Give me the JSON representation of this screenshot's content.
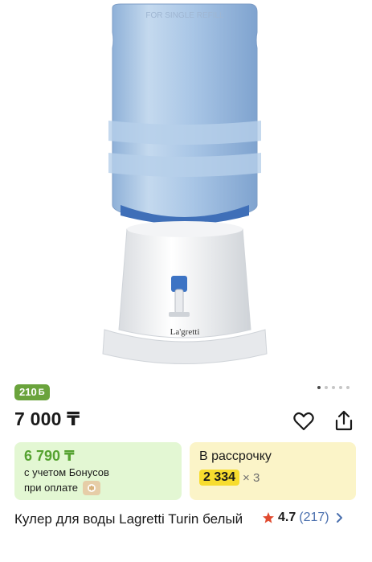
{
  "product": {
    "bonus_badge": "210",
    "bonus_badge_currency": "Б",
    "price": "7 000 ₸",
    "title": "Кулер для воды Lagretti Turin белый",
    "rating": "4.7",
    "reviews": "(217)",
    "image_brand": "La'gretti",
    "image_bottle_text": "FOR SINGLE REFILL"
  },
  "bonus_card": {
    "price": "6 790 ₸",
    "line1": "с учетом Бонусов",
    "line2": "при оплате"
  },
  "installment_card": {
    "title": "В рассрочку",
    "monthly": "2 334",
    "multiplier": "× 3"
  },
  "gallery": {
    "total": 5,
    "active": 0
  },
  "colors": {
    "bonus_green": "#6aa33c",
    "bonus_card_bg": "#e3f7d3",
    "install_card_bg": "#fbf4c8",
    "monthly_yellow": "#f7dc2e",
    "star_red": "#e04a2f",
    "reviews_blue": "#4a6fae"
  },
  "icons": [
    "heart-icon",
    "share-icon",
    "star-icon",
    "chevron-right-icon",
    "wallet-icon"
  ]
}
